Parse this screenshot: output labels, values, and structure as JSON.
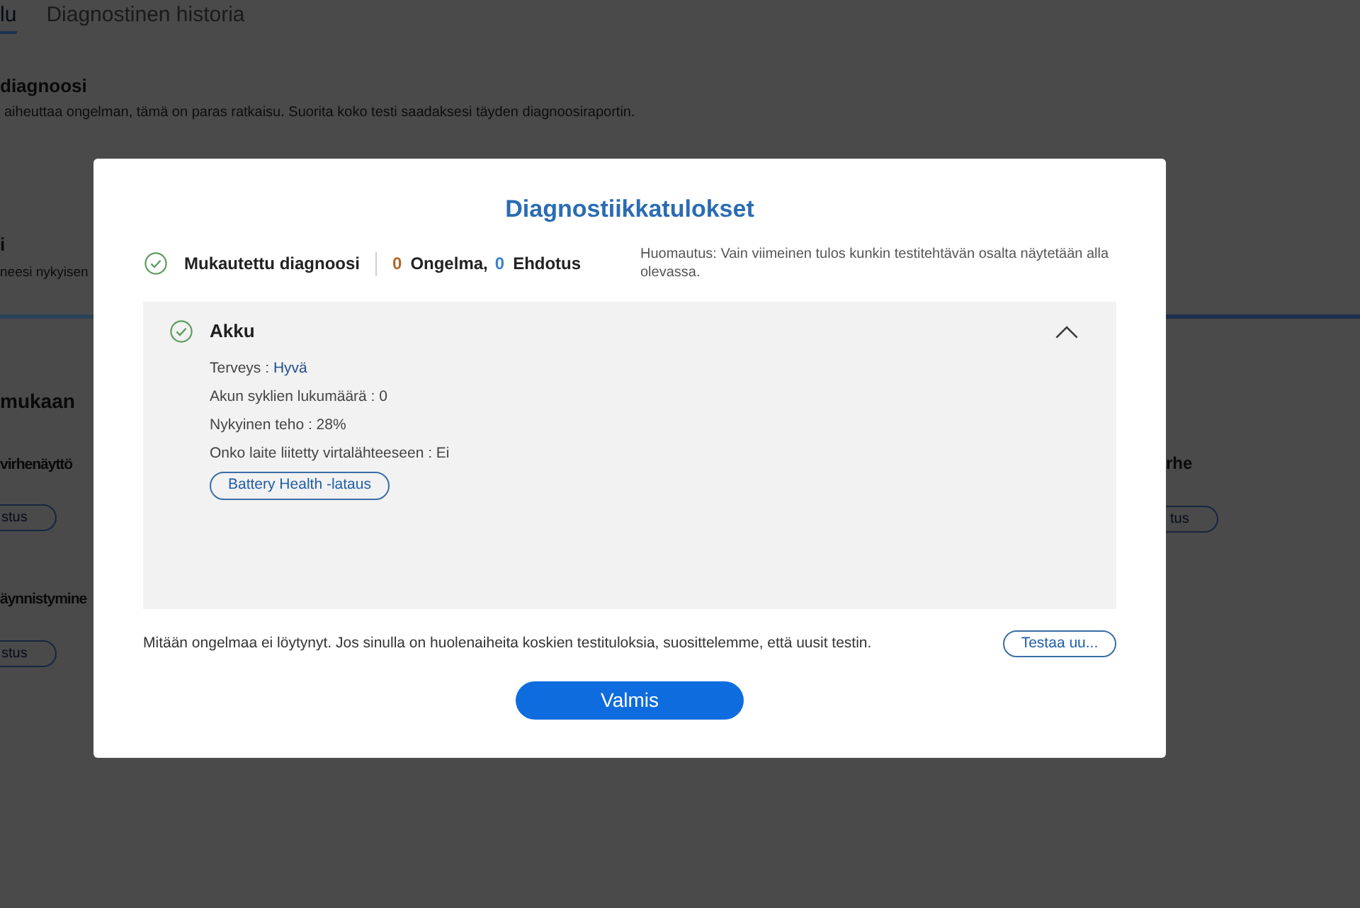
{
  "page": {
    "tabs": [
      {
        "label": "lu",
        "selected": true
      },
      {
        "label": "Diagnostinen historia",
        "selected": false
      }
    ],
    "full_scan": {
      "title": "diagnoosi",
      "description": "aiheuttaa ongelman, tämä on paras ratkaisu. Suorita koko testi saadaksesi täyden diagnoosiraportin."
    },
    "custom_scan": {
      "title": "i",
      "description": "neesi nykyisen"
    },
    "symptoms": {
      "heading": "mukaan",
      "left_cards": [
        {
          "title": "virhenäyttö",
          "button": "stus"
        },
        {
          "title": "äynnistymine",
          "button": "stus"
        }
      ],
      "right_cards": [
        {
          "title": "rhe",
          "button": "tus"
        }
      ]
    }
  },
  "dialog": {
    "title": "Diagnostiikkatulokset",
    "summary": {
      "passed": true,
      "name": "Mukautettu diagnoosi",
      "counts": [
        {
          "count": "0",
          "label": "Ongelma,",
          "color": "#b0682c"
        },
        {
          "count": "0",
          "label": "Ehdotus",
          "color": "#3b7fd0"
        }
      ],
      "note": "Huomautus: Vain viimeinen tulos kunkin testitehtävän osalta näytetään alla olevassa."
    },
    "results": [
      {
        "passed": true,
        "name": "Akku",
        "expanded": true,
        "details": [
          {
            "label": "Terveys :",
            "value": "Hyvä",
            "kind": "rating"
          },
          {
            "label": "Akun syklien lukumäärä :",
            "value": "0",
            "kind": "plain"
          },
          {
            "label": "Nykyinen teho :",
            "value": "28%",
            "kind": "plain"
          },
          {
            "label": "Onko laite liitetty virtalähteeseen :",
            "value": "Ei",
            "kind": "plain"
          }
        ],
        "action": "Battery Health -lataus"
      }
    ],
    "footer_text": "Mitään ongelmaa ei löytynyt. Jos sinulla on huolenaiheita koskien testituloksia, suosittelemme, että uusit testin.",
    "retest_button": "Testaa uu...",
    "done_button": "Valmis"
  }
}
